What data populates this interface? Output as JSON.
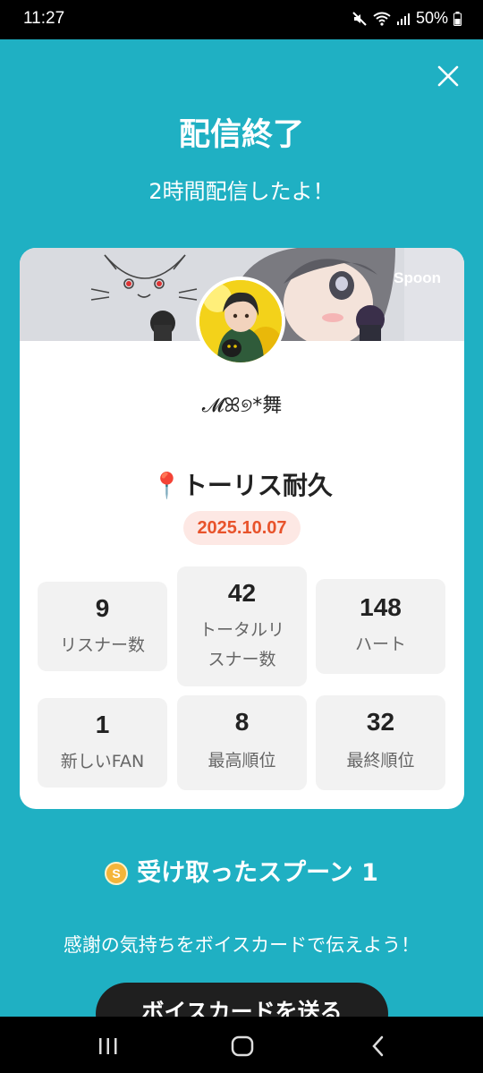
{
  "status_bar": {
    "time": "11:27",
    "battery": "50%"
  },
  "header": {
    "title": "配信終了",
    "subtitle": "2時間配信したよ！"
  },
  "card": {
    "brand": "Spoon",
    "nickname": "𝓜ꕤ୭*舞",
    "stream_title": "📍トーリス耐久",
    "date": "2025.10.07",
    "stats": [
      {
        "value": "9",
        "label": "リスナー数"
      },
      {
        "value": "42",
        "label_line1": "トータルリ",
        "label_line2": "スナー数"
      },
      {
        "value": "148",
        "label": "ハート"
      },
      {
        "value": "1",
        "label": "新しいFAN"
      },
      {
        "value": "8",
        "label": "最高順位"
      },
      {
        "value": "32",
        "label": "最終順位"
      }
    ]
  },
  "spoons": {
    "label": "受け取ったスプーン 1",
    "coin_letter": "S"
  },
  "message": "感謝の気持ちをボイスカードで伝えよう！",
  "voice_card_button": "ボイスカードを送る",
  "colors": {
    "background": "#1fb0c3",
    "date_text": "#e8532b",
    "date_bg": "#fde8e4",
    "button": "#1f1f1f"
  }
}
